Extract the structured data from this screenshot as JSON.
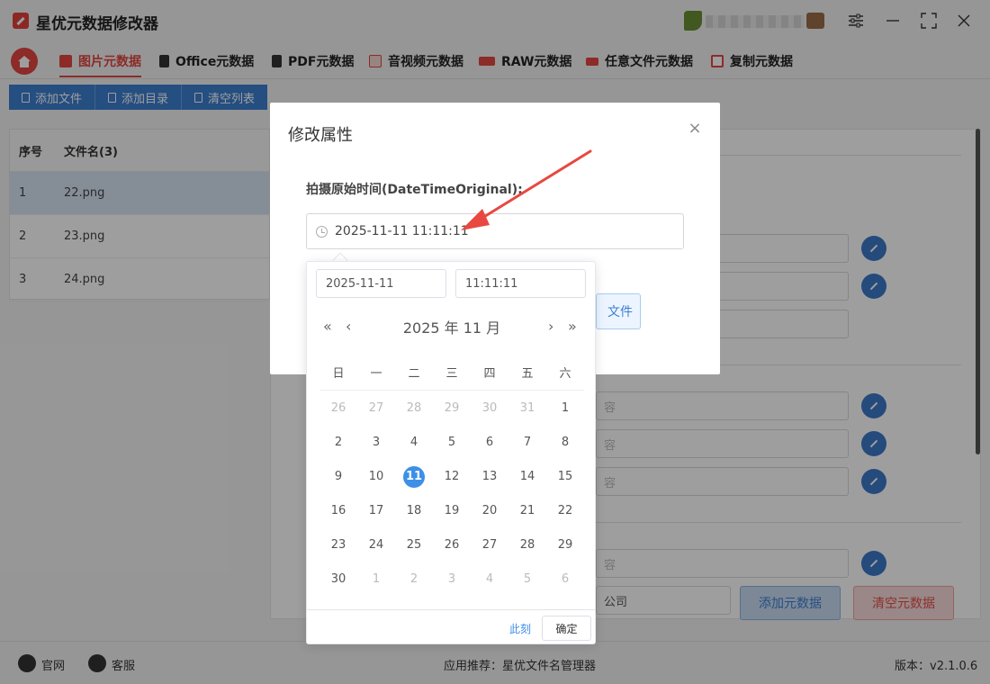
{
  "app": {
    "title": "星优元数据修改器"
  },
  "tabs": [
    {
      "label": "图片元数据",
      "color": "#e2463f"
    },
    {
      "label": "Office元数据",
      "color": "#333333"
    },
    {
      "label": "PDF元数据",
      "color": "#333333"
    },
    {
      "label": "音视频元数据",
      "color": "#e2463f"
    },
    {
      "label": "RAW元数据",
      "color": "#e2463f"
    },
    {
      "label": "任意文件元数据",
      "color": "#e2463f"
    },
    {
      "label": "复制元数据",
      "color": "#e2463f"
    }
  ],
  "toolbar": {
    "add_file": "添加文件",
    "add_dir": "添加目录",
    "clear_list": "清空列表"
  },
  "filetable": {
    "headers": {
      "no": "序号",
      "name": "文件名(3)"
    },
    "rows": [
      {
        "no": "1",
        "name": "22.png"
      },
      {
        "no": "2",
        "name": "23.png"
      },
      {
        "no": "3",
        "name": "24.png"
      }
    ]
  },
  "right_panel": {
    "placeholder_partial": "容",
    "company_partial": "公司",
    "add_meta": "添加元数据",
    "clear_meta": "清空元数据"
  },
  "footer": {
    "website": "官网",
    "support": "客服",
    "recommend_label": "应用推荐：",
    "recommend_app": "星优文件名管理器",
    "version": "版本：v2.1.0.6"
  },
  "modal": {
    "title": "修改属性",
    "close": "×",
    "field_label": "拍摄原始时间(DateTimeOriginal):",
    "value": "2025-11-11 11:11:11",
    "select_file_partial": "文件"
  },
  "picker": {
    "date": "2025-11-11",
    "time": "11:11:11",
    "header": "2025 年  11 月",
    "weekdays": [
      "日",
      "一",
      "二",
      "三",
      "四",
      "五",
      "六"
    ],
    "weeks": [
      [
        [
          "26",
          1
        ],
        [
          "27",
          1
        ],
        [
          "28",
          1
        ],
        [
          "29",
          1
        ],
        [
          "30",
          1
        ],
        [
          "31",
          1
        ],
        [
          "1",
          0
        ]
      ],
      [
        [
          "2",
          0
        ],
        [
          "3",
          0
        ],
        [
          "4",
          0
        ],
        [
          "5",
          0
        ],
        [
          "6",
          0
        ],
        [
          "7",
          0
        ],
        [
          "8",
          0
        ]
      ],
      [
        [
          "9",
          0
        ],
        [
          "10",
          0
        ],
        [
          "11",
          2
        ],
        [
          "12",
          0
        ],
        [
          "13",
          0
        ],
        [
          "14",
          0
        ],
        [
          "15",
          0
        ]
      ],
      [
        [
          "16",
          0
        ],
        [
          "17",
          0
        ],
        [
          "18",
          0
        ],
        [
          "19",
          0
        ],
        [
          "20",
          0
        ],
        [
          "21",
          0
        ],
        [
          "22",
          0
        ]
      ],
      [
        [
          "23",
          0
        ],
        [
          "24",
          0
        ],
        [
          "25",
          0
        ],
        [
          "26",
          0
        ],
        [
          "27",
          0
        ],
        [
          "28",
          0
        ],
        [
          "29",
          0
        ]
      ],
      [
        [
          "30",
          0
        ],
        [
          "1",
          1
        ],
        [
          "2",
          1
        ],
        [
          "3",
          1
        ],
        [
          "4",
          1
        ],
        [
          "5",
          1
        ],
        [
          "6",
          1
        ]
      ]
    ],
    "now": "此刻",
    "ok": "确定"
  }
}
